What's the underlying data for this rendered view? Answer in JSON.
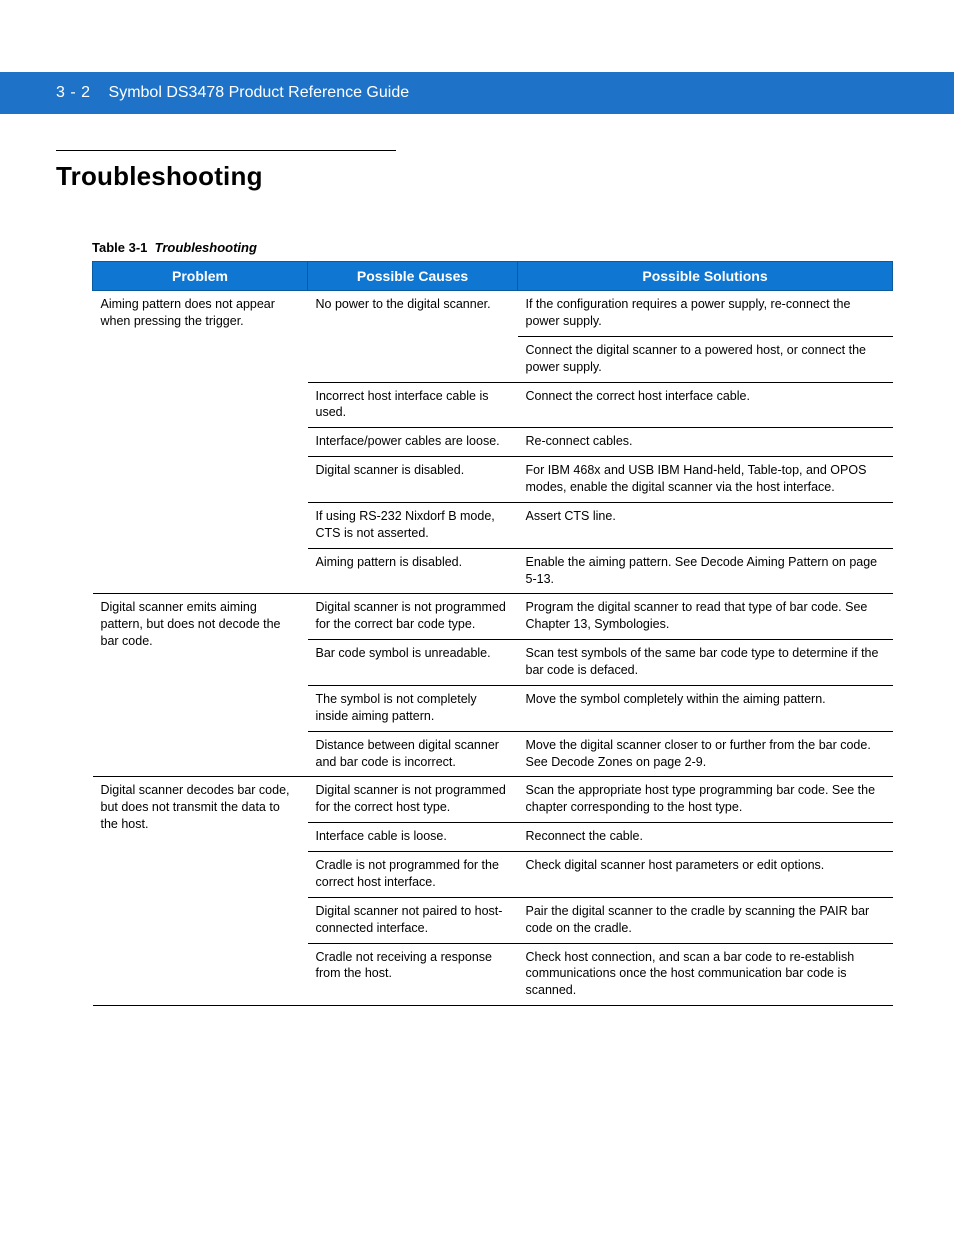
{
  "header": {
    "page_number": "3 - 2",
    "guide_title": "Symbol DS3478 Product Reference Guide"
  },
  "section_title": "Troubleshooting",
  "table": {
    "caption_prefix": "Table 3-1",
    "caption_title": "Troubleshooting",
    "columns": [
      "Problem",
      "Possible Causes",
      "Possible Solutions"
    ],
    "rows": [
      {
        "problem": "Aiming pattern does not appear when pressing the trigger.",
        "causes": [
          {
            "cause": "No power to the digital scanner.",
            "solutions": [
              "If the configuration requires a power supply, re-connect the power supply.",
              "Connect the digital scanner to a powered host, or connect the power supply."
            ]
          },
          {
            "cause": "Incorrect host interface cable is used.",
            "solutions": [
              "Connect the correct host interface cable."
            ]
          },
          {
            "cause": "Interface/power cables are loose.",
            "solutions": [
              "Re-connect cables."
            ]
          },
          {
            "cause": "Digital scanner is disabled.",
            "solutions": [
              "For IBM 468x and USB IBM Hand-held, Table-top, and OPOS modes, enable the digital scanner via the host interface."
            ]
          },
          {
            "cause": "If using RS-232 Nixdorf B mode, CTS is not asserted.",
            "solutions": [
              "Assert CTS line."
            ]
          },
          {
            "cause": "Aiming pattern is disabled.",
            "solutions": [
              "Enable the aiming pattern. See Decode Aiming Pattern on page 5-13."
            ]
          }
        ]
      },
      {
        "problem": "Digital scanner emits aiming pattern, but does not decode the bar code.",
        "causes": [
          {
            "cause": "Digital scanner is not programmed for the correct bar code type.",
            "solutions": [
              "Program the digital scanner to read that type of bar code. See Chapter 13, Symbologies."
            ]
          },
          {
            "cause": "Bar code symbol is unreadable.",
            "solutions": [
              "Scan test symbols of the same bar code type to determine if the bar code is defaced."
            ]
          },
          {
            "cause": "The symbol is not completely inside aiming pattern.",
            "solutions": [
              "Move the symbol completely within the aiming pattern."
            ]
          },
          {
            "cause": "Distance between digital scanner and bar code is incorrect.",
            "solutions": [
              "Move the digital scanner closer to or further from the bar code. See Decode Zones on page 2-9."
            ]
          }
        ]
      },
      {
        "problem": "Digital scanner decodes bar code, but does not transmit the data to the host.",
        "causes": [
          {
            "cause": "Digital scanner is not programmed for the correct host type.",
            "solutions": [
              "Scan the appropriate host type programming bar code. See the chapter corresponding to the host type."
            ]
          },
          {
            "cause": "Interface cable is loose.",
            "solutions": [
              "Reconnect the cable."
            ]
          },
          {
            "cause": "Cradle is not programmed for the correct host interface.",
            "solutions": [
              "Check digital scanner host parameters or edit options."
            ]
          },
          {
            "cause": "Digital scanner not paired to host-connected interface.",
            "solutions": [
              "Pair the digital scanner to the cradle by scanning the PAIR bar code on the cradle."
            ]
          },
          {
            "cause": "Cradle not receiving a response from the host.",
            "solutions": [
              "Check host connection, and scan a bar code to re-establish communications once the host communication bar code is scanned."
            ]
          }
        ]
      }
    ]
  }
}
